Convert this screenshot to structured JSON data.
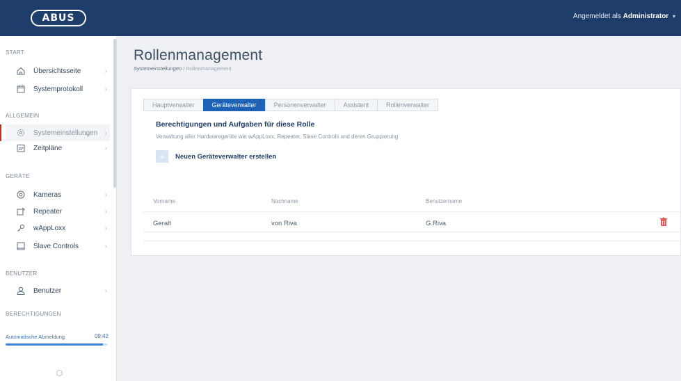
{
  "header": {
    "logo_text": "ABUS",
    "user_prefix": "Angemeldet als",
    "user_name": "Administrator"
  },
  "sidebar": {
    "sections": {
      "start": "START",
      "allgemein": "ALLGEMEIN",
      "geraete": "GERÄTE",
      "benutzer": "BENUTZER",
      "berechtigungen": "BERECHTIGUNGEN"
    },
    "items": [
      {
        "label": "Übersichtsseite",
        "icon": "home-icon"
      },
      {
        "label": "Systemprotokoll",
        "icon": "calendar-icon"
      },
      {
        "label": "Systemeinstellungen",
        "icon": "gear-icon",
        "active": true
      },
      {
        "label": "Zeitpläne",
        "icon": "schedule-icon"
      },
      {
        "label": "Kameras",
        "icon": "camera-icon"
      },
      {
        "label": "Repeater",
        "icon": "repeater-icon"
      },
      {
        "label": "wAppLoxx",
        "icon": "key-icon"
      },
      {
        "label": "Slave Controls",
        "icon": "tablet-icon"
      },
      {
        "label": "Benutzer",
        "icon": "user-icon"
      }
    ],
    "auto_logout": {
      "label": "Automatische Abmeldung",
      "time": "09:42",
      "progress": 0.96
    }
  },
  "main": {
    "title": "Rollenmanagement",
    "breadcrumb": {
      "home": "Systemeinstellungen",
      "separator": "/",
      "current": "Rollenmanagement"
    },
    "tabs": [
      {
        "label": "Hauptverwalter"
      },
      {
        "label": "Geräteverwalter",
        "active": true
      },
      {
        "label": "Personenverwalter"
      },
      {
        "label": "Assistent"
      },
      {
        "label": "Rollenverwalter"
      }
    ],
    "section_title": "Berechtigungen und Aufgaben für diese Rolle",
    "section_desc": "Verwaltung aller Hardwaregeräte wie wAppLoxx, Repeater, Slave Controls und deren Gruppierung",
    "add_label": "Neuen Geräteverwalter erstellen",
    "add_symbol": "+",
    "table": {
      "columns": [
        "Vorname",
        "Nachname",
        "Benutzername"
      ],
      "rows": [
        {
          "vorname": "Geralt",
          "nachname": "von Riva",
          "benutzername": "G.Riva"
        }
      ]
    }
  },
  "colors": {
    "header_bg": "#1f3d6b",
    "accent": "#1f63b8",
    "active_marker": "#c9302c",
    "delete": "#e05a5a"
  }
}
